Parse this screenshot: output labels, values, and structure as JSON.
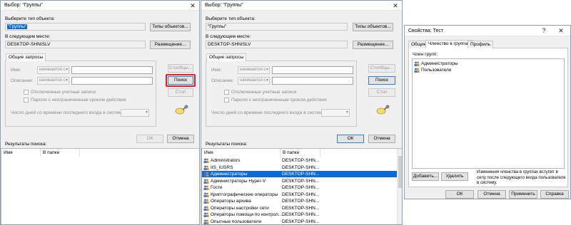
{
  "window1": {
    "title": "Выбор: \"Группы\"",
    "object_type_label": "Выберите тип объекта:",
    "object_type_value": "\"Группы\"",
    "object_types_button": "Типы объектов...",
    "location_label": "В следующем месте:",
    "location_value": "DESKTOP-SHNISLV",
    "location_button": "Размещение...",
    "tab_label": "Общие запросы",
    "name_label": "Имя:",
    "name_mode": "начинается с",
    "description_label": "Описание:",
    "description_mode": "начинается с",
    "disabled_accounts": "Отключенные учетные записи",
    "no_expire_passwords": "Пароли с неограниченным сроком действия",
    "days_since_login": "Число дней со времени последнего входа в систему:",
    "columns_button": "Столбцы...",
    "search_button": "Поиск",
    "stop_button": "Стоп",
    "ok_button": "ОК",
    "cancel_button": "Отмена",
    "results_label": "Результаты поиска:",
    "col_name": "Имя",
    "col_folder": "В папке"
  },
  "window2": {
    "title": "Выбор: \"Группы\"",
    "object_type_label": "Выберите тип объекта:",
    "object_type_value": "\"Группы\"",
    "object_types_button": "Типы объектов...",
    "location_label": "В следующем месте:",
    "location_value": "DESKTOP-SHNISLV",
    "location_button": "Размещение...",
    "tab_label": "Общие запросы",
    "name_label": "Имя:",
    "name_mode": "начинается с",
    "description_label": "Описание:",
    "description_mode": "начинается с",
    "disabled_accounts": "Отключенные учетные записи",
    "no_expire_passwords": "Пароли с неограниченным сроком действия",
    "days_since_login": "Число дней со времени последнего входа в систему:",
    "columns_button": "Столбцы...",
    "search_button": "Поиск",
    "stop_button": "Стоп",
    "ok_button": "ОК",
    "cancel_button": "Отмена",
    "results_label": "Результаты поиска:",
    "col_name": "Имя",
    "col_folder": "В папке",
    "rows": [
      {
        "name": "Administrators",
        "folder": "DESKTOP-SHN..."
      },
      {
        "name": "IIS_IUSRS",
        "folder": "DESKTOP-SHN..."
      },
      {
        "name": "Администраторы",
        "folder": "DESKTOP-SHN..."
      },
      {
        "name": "Администраторы Hyper-V",
        "folder": "DESKTOP-SHN..."
      },
      {
        "name": "Гости",
        "folder": "DESKTOP-SHN..."
      },
      {
        "name": "Криптографические операторы",
        "folder": "DESKTOP-SHN..."
      },
      {
        "name": "Операторы архива",
        "folder": "DESKTOP-SHN..."
      },
      {
        "name": "Операторы настройки сети",
        "folder": "DESKTOP-SHN..."
      },
      {
        "name": "Операторы помощи по контрол...",
        "folder": "DESKTOP-SHN..."
      },
      {
        "name": "Опытные пользователи",
        "folder": "DESKTOP-SHN..."
      }
    ],
    "selected_row": 2
  },
  "window3": {
    "title": "Свойства: Тест",
    "help_glyph": "?",
    "tabs": [
      "Общие",
      "Членство в группах",
      "Профиль"
    ],
    "member_of_label": "Член групп:",
    "groups": [
      "Администраторы",
      "Пользователи"
    ],
    "add_button": "Добавить...",
    "remove_button": "Удалить",
    "note": "Изменения членства в группах вступят в силу после следующего входа пользователя в систему.",
    "ok_button": "ОК",
    "cancel_button": "Отмена",
    "apply_button": "Применить",
    "help_button": "Справка"
  },
  "colors": {
    "selection": "#0a6ad6",
    "highlight_border": "#e02020",
    "window_bg": "#f0f0f0"
  }
}
